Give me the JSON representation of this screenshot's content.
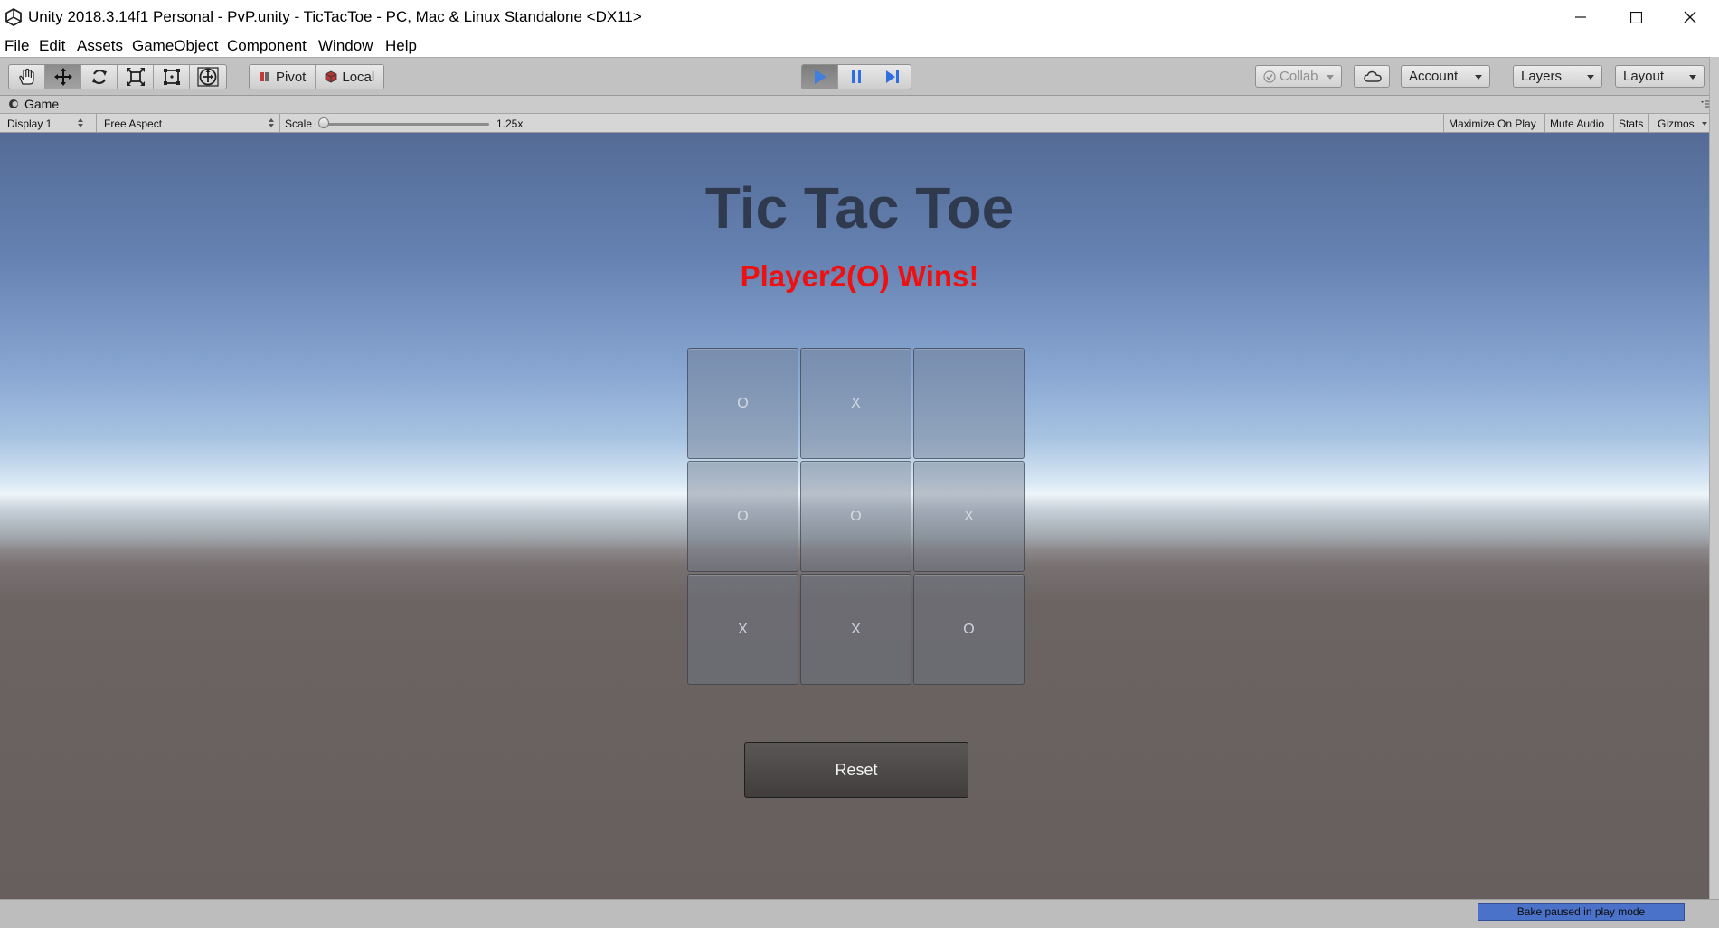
{
  "window": {
    "title": "Unity 2018.3.14f1 Personal - PvP.unity - TicTacToe - PC, Mac & Linux Standalone <DX11>"
  },
  "menu": [
    "File",
    "Edit",
    "Assets",
    "GameObject",
    "Component",
    "Window",
    "Help"
  ],
  "toolbar": {
    "tools": [
      "hand-tool-icon",
      "move-tool-icon",
      "rotate-tool-icon",
      "scale-tool-icon",
      "rect-tool-icon",
      "transform-tool-icon"
    ],
    "pivot_label": "Pivot",
    "local_label": "Local",
    "collab_label": "Collab",
    "account_label": "Account",
    "layers_label": "Layers",
    "layout_label": "Layout",
    "play_active": true
  },
  "game_view": {
    "tab_label": "Game",
    "display_label": "Display 1",
    "aspect_label": "Free Aspect",
    "scale_label": "Scale",
    "scale_value": "1.25x",
    "maximize_label": "Maximize On Play",
    "mute_label": "Mute Audio",
    "stats_label": "Stats",
    "gizmos_label": "Gizmos"
  },
  "game": {
    "title": "Tic Tac Toe",
    "status": "Player2(O) Wins!",
    "board": [
      "O",
      "X",
      "",
      "O",
      "O",
      "X",
      "X",
      "X",
      "O"
    ],
    "reset_label": "Reset"
  },
  "status_bar": {
    "bake_status": "Bake paused in play mode"
  },
  "colors": {
    "accent_play": "#3f7fe0",
    "status_text": "#ee1111",
    "title_text": "#2f3a4f"
  }
}
